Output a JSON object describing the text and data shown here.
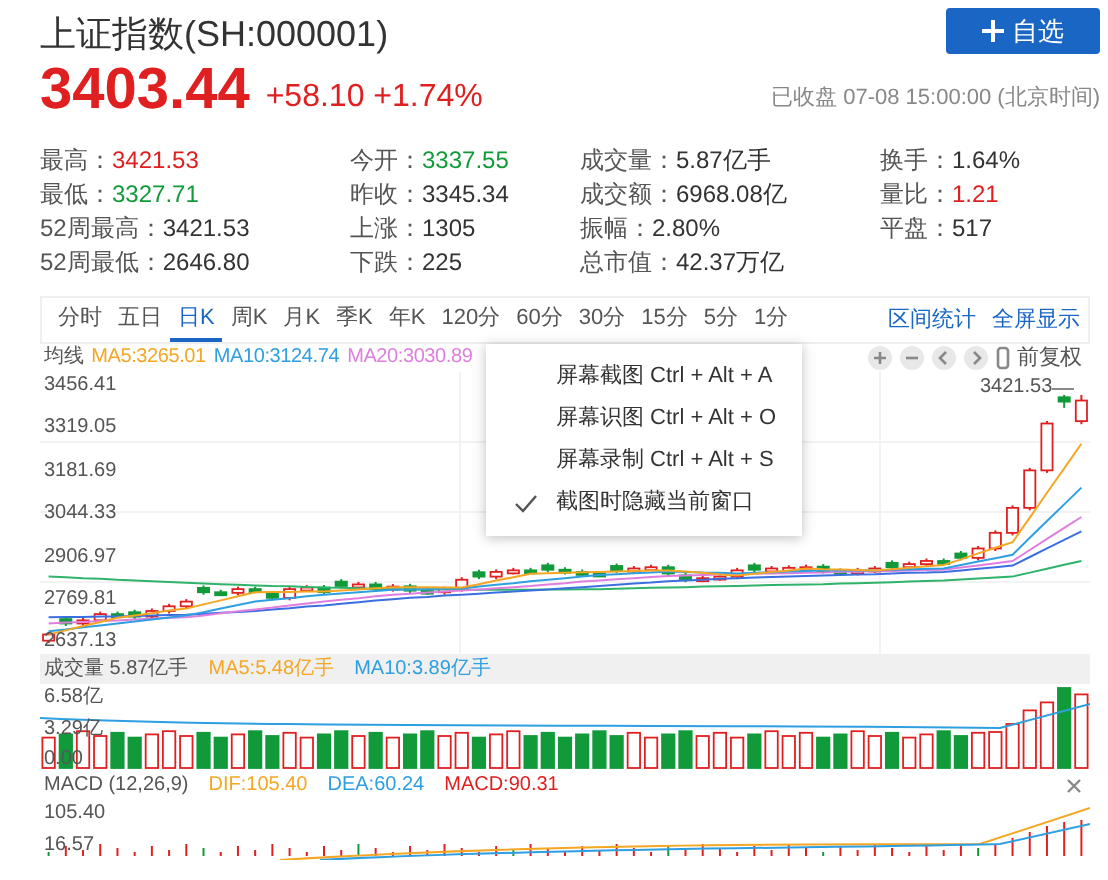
{
  "header": {
    "title": "上证指数(SH:000001)",
    "watch_button": "自选"
  },
  "quote": {
    "price": "3403.44",
    "change": "+58.10",
    "change_pct": "+1.74%",
    "status": "已收盘 07-08 15:00:00 (北京时间)"
  },
  "stats": [
    [
      {
        "label": "最高：",
        "value": "3421.53",
        "color": "#e02020"
      },
      {
        "label": "今开：",
        "value": "3337.55",
        "color": "#119a3a"
      },
      {
        "label": "成交量：",
        "value": "5.87亿手",
        "color": "#333333"
      },
      {
        "label": "换手：",
        "value": "1.64%",
        "color": "#333333"
      }
    ],
    [
      {
        "label": "最低：",
        "value": "3327.71",
        "color": "#119a3a"
      },
      {
        "label": "昨收：",
        "value": "3345.34",
        "color": "#333333"
      },
      {
        "label": "成交额：",
        "value": "6968.08亿",
        "color": "#333333"
      },
      {
        "label": "量比：",
        "value": "1.21",
        "color": "#e02020"
      }
    ],
    [
      {
        "label": "52周最高：",
        "value": "3421.53",
        "color": "#333333"
      },
      {
        "label": "上涨：",
        "value": "1305",
        "color": "#333333"
      },
      {
        "label": "振幅：",
        "value": "2.80%",
        "color": "#333333"
      },
      {
        "label": "平盘：",
        "value": "517",
        "color": "#333333"
      }
    ],
    [
      {
        "label": "52周最低：",
        "value": "2646.80",
        "color": "#333333"
      },
      {
        "label": "下跌：",
        "value": "225",
        "color": "#333333"
      },
      {
        "label": "总市值：",
        "value": "42.37万亿",
        "color": "#333333"
      }
    ]
  ],
  "periods": [
    {
      "label": "分时",
      "selected": false
    },
    {
      "label": "五日",
      "selected": false
    },
    {
      "label": "日K",
      "selected": true
    },
    {
      "label": "周K",
      "selected": false
    },
    {
      "label": "月K",
      "selected": false
    },
    {
      "label": "季K",
      "selected": false
    },
    {
      "label": "年K",
      "selected": false
    },
    {
      "label": "120分",
      "selected": false
    },
    {
      "label": "60分",
      "selected": false
    },
    {
      "label": "30分",
      "selected": false
    },
    {
      "label": "15分",
      "selected": false
    },
    {
      "label": "5分",
      "selected": false
    },
    {
      "label": "1分",
      "selected": false
    }
  ],
  "tools": [
    "区间统计",
    "全屏显示"
  ],
  "ma_legend": [
    {
      "label": "均线",
      "color": "#555555"
    },
    {
      "label": "MA5:3265.01",
      "color": "#f5a623"
    },
    {
      "label": "MA10:3124.74",
      "color": "#2e9fe0"
    },
    {
      "label": "MA20:3030.89",
      "color": "#e07ee0"
    }
  ],
  "adjust_label": "前复权",
  "price_chart": {
    "chart_data": {
      "type": "candlestick",
      "ylim": [
        2637.13,
        3456.41
      ],
      "yticks": [
        3456.41,
        3319.05,
        3181.69,
        3044.33,
        2906.97,
        2769.81,
        2637.13
      ],
      "ohlc": [
        [
          2635,
          2663,
          2627,
          2655
        ],
        [
          2704,
          2712,
          2682,
          2690
        ],
        [
          2690,
          2708,
          2682,
          2700
        ],
        [
          2700,
          2728,
          2692,
          2720
        ],
        [
          2720,
          2728,
          2707,
          2715
        ],
        [
          2726,
          2734,
          2704,
          2712
        ],
        [
          2712,
          2738,
          2704,
          2730
        ],
        [
          2730,
          2753,
          2722,
          2745
        ],
        [
          2745,
          2768,
          2737,
          2760
        ],
        [
          2804,
          2812,
          2782,
          2790
        ],
        [
          2790,
          2798,
          2780,
          2788
        ],
        [
          2788,
          2808,
          2780,
          2800
        ],
        [
          2800,
          2808,
          2787,
          2795
        ],
        [
          2786,
          2794,
          2764,
          2772
        ],
        [
          2772,
          2808,
          2764,
          2800
        ],
        [
          2800,
          2813,
          2792,
          2805
        ],
        [
          2805,
          2813,
          2782,
          2790
        ],
        [
          2824,
          2832,
          2802,
          2810
        ],
        [
          2810,
          2823,
          2802,
          2815
        ],
        [
          2815,
          2823,
          2792,
          2800
        ],
        [
          2800,
          2816,
          2792,
          2808
        ],
        [
          2809,
          2817,
          2787,
          2795
        ],
        [
          2795,
          2803,
          2782,
          2790
        ],
        [
          2790,
          2808,
          2782,
          2800
        ],
        [
          2800,
          2838,
          2792,
          2830
        ],
        [
          2854,
          2862,
          2832,
          2840
        ],
        [
          2840,
          2863,
          2832,
          2855
        ],
        [
          2855,
          2868,
          2847,
          2860
        ],
        [
          2860,
          2868,
          2850,
          2858
        ],
        [
          2876,
          2884,
          2854,
          2862
        ],
        [
          2862,
          2870,
          2847,
          2855
        ],
        [
          2855,
          2863,
          2842,
          2850
        ],
        [
          2850,
          2858,
          2840,
          2848
        ],
        [
          2874,
          2882,
          2852,
          2860
        ],
        [
          2860,
          2874,
          2852,
          2866
        ],
        [
          2866,
          2878,
          2858,
          2870
        ],
        [
          2870,
          2878,
          2842,
          2850
        ],
        [
          2844,
          2852,
          2822,
          2830
        ],
        [
          2830,
          2843,
          2822,
          2835
        ],
        [
          2835,
          2848,
          2827,
          2840
        ],
        [
          2840,
          2868,
          2832,
          2860
        ],
        [
          2876,
          2884,
          2854,
          2862
        ],
        [
          2862,
          2874,
          2854,
          2866
        ],
        [
          2866,
          2876,
          2858,
          2868
        ],
        [
          2868,
          2878,
          2860,
          2870
        ],
        [
          2872,
          2880,
          2850,
          2858
        ],
        [
          2858,
          2866,
          2844,
          2852
        ],
        [
          2852,
          2868,
          2844,
          2860
        ],
        [
          2860,
          2874,
          2852,
          2866
        ],
        [
          2884,
          2892,
          2862,
          2870
        ],
        [
          2870,
          2888,
          2862,
          2880
        ],
        [
          2880,
          2898,
          2872,
          2890
        ],
        [
          2890,
          2898,
          2877,
          2885
        ],
        [
          2914,
          2922,
          2892,
          2900
        ],
        [
          2900,
          2938,
          2892,
          2930
        ],
        [
          2930,
          2988,
          2922,
          2980
        ],
        [
          2980,
          3068,
          2972,
          3060
        ],
        [
          3060,
          3188,
          3052,
          3180
        ],
        [
          3180,
          3338,
          3172,
          3330
        ],
        [
          3414,
          3421.53,
          3380,
          3400
        ],
        [
          3337.55,
          3421.53,
          3327.71,
          3403.44
        ]
      ]
    }
  },
  "moving_averages": {
    "chart_data": {
      "type": "line",
      "ylim": [
        2637.13,
        3456.41
      ],
      "series": [
        {
          "color": "#2fb36a",
          "values": [
            2840,
            2838,
            2835,
            2833,
            2830,
            2828,
            2825,
            2823,
            2820,
            2818,
            2816,
            2814,
            2812,
            2810,
            2809,
            2807,
            2805,
            2804,
            2803,
            2801,
            2800,
            2800,
            2799,
            2799,
            2798,
            2798,
            2798,
            2798,
            2798,
            2799,
            2799,
            2800,
            2800,
            2801,
            2803,
            2804,
            2805,
            2806,
            2808,
            2809,
            2810,
            2811,
            2813,
            2814,
            2815,
            2816,
            2818,
            2819,
            2820,
            2822,
            2824,
            2826,
            2828,
            2831,
            2834,
            2837,
            2840,
            2853,
            2865,
            2878,
            2890
          ]
        },
        {
          "color": "#3b6fe0",
          "values": [
            2710,
            2711,
            2711,
            2712,
            2712,
            2714,
            2715,
            2717,
            2718,
            2721,
            2724,
            2727,
            2730,
            2735,
            2739,
            2744,
            2748,
            2753,
            2758,
            2763,
            2768,
            2772,
            2775,
            2779,
            2782,
            2785,
            2789,
            2792,
            2795,
            2799,
            2803,
            2806,
            2810,
            2814,
            2818,
            2821,
            2825,
            2828,
            2830,
            2833,
            2835,
            2837,
            2839,
            2840,
            2842,
            2844,
            2845,
            2847,
            2848,
            2850,
            2852,
            2853,
            2855,
            2860,
            2865,
            2870,
            2875,
            2903,
            2930,
            2958,
            2985
          ]
        },
        {
          "color": "#e07ee0",
          "values": [
            2690,
            2693,
            2695,
            2698,
            2700,
            2703,
            2705,
            2708,
            2710,
            2716,
            2723,
            2729,
            2735,
            2741,
            2748,
            2754,
            2760,
            2766,
            2771,
            2777,
            2782,
            2785,
            2789,
            2792,
            2795,
            2799,
            2803,
            2806,
            2810,
            2815,
            2819,
            2824,
            2828,
            2832,
            2835,
            2839,
            2842,
            2844,
            2845,
            2847,
            2848,
            2849,
            2850,
            2851,
            2852,
            2853,
            2855,
            2856,
            2857,
            2858,
            2860,
            2861,
            2862,
            2869,
            2876,
            2883,
            2890,
            2925,
            2961,
            2996,
            3031
          ]
        },
        {
          "color": "#2e9fe0",
          "values": [
            2665,
            2671,
            2678,
            2684,
            2690,
            2696,
            2703,
            2709,
            2715,
            2726,
            2738,
            2749,
            2760,
            2766,
            2771,
            2777,
            2782,
            2786,
            2790,
            2794,
            2798,
            2799,
            2800,
            2801,
            2802,
            2808,
            2814,
            2819,
            2825,
            2830,
            2835,
            2840,
            2845,
            2848,
            2851,
            2853,
            2856,
            2855,
            2853,
            2852,
            2850,
            2852,
            2854,
            2856,
            2858,
            2859,
            2859,
            2860,
            2860,
            2862,
            2863,
            2865,
            2866,
            2877,
            2888,
            2899,
            2910,
            2964,
            3018,
            3071,
            3125
          ]
        },
        {
          "color": "#f5a623",
          "values": [
            2655,
            2668,
            2682,
            2695,
            2708,
            2716,
            2723,
            2731,
            2738,
            2751,
            2764,
            2777,
            2790,
            2791,
            2791,
            2792,
            2792,
            2796,
            2799,
            2803,
            2806,
            2806,
            2806,
            2805,
            2805,
            2816,
            2827,
            2838,
            2849,
            2851,
            2852,
            2854,
            2855,
            2856,
            2858,
            2859,
            2860,
            2856,
            2852,
            2847,
            2843,
            2849,
            2855,
            2860,
            2866,
            2864,
            2863,
            2861,
            2859,
            2864,
            2868,
            2873,
            2877,
            2895,
            2914,
            2932,
            2950,
            3029,
            3108,
            3186,
            3265
          ]
        }
      ]
    }
  },
  "high_marker": "3421.53",
  "volume": {
    "legend": [
      {
        "label": "成交量 5.87亿手",
        "color": "#555555"
      },
      {
        "label": "MA5:5.48亿手",
        "color": "#f5a623"
      },
      {
        "label": "MA10:3.89亿手",
        "color": "#2e9fe0"
      }
    ],
    "axis": [
      "6.58亿",
      "3.29亿",
      "0.00"
    ]
  },
  "macd": {
    "legend": [
      {
        "label": "MACD (12,26,9)",
        "color": "#555555"
      },
      {
        "label": "DIF:105.40",
        "color": "#f5a623"
      },
      {
        "label": "DEA:60.24",
        "color": "#2e9fe0"
      },
      {
        "label": "MACD:90.31",
        "color": "#e02020"
      }
    ],
    "axis": [
      "105.40",
      "16.57"
    ]
  },
  "context_menu": [
    {
      "label": "屏幕截图 Ctrl + Alt + A",
      "checked": false
    },
    {
      "label": "屏幕识图 Ctrl + Alt + O",
      "checked": false
    },
    {
      "label": "屏幕录制 Ctrl + Alt + S",
      "checked": false
    },
    {
      "label": "截图时隐藏当前窗口",
      "checked": true
    }
  ]
}
